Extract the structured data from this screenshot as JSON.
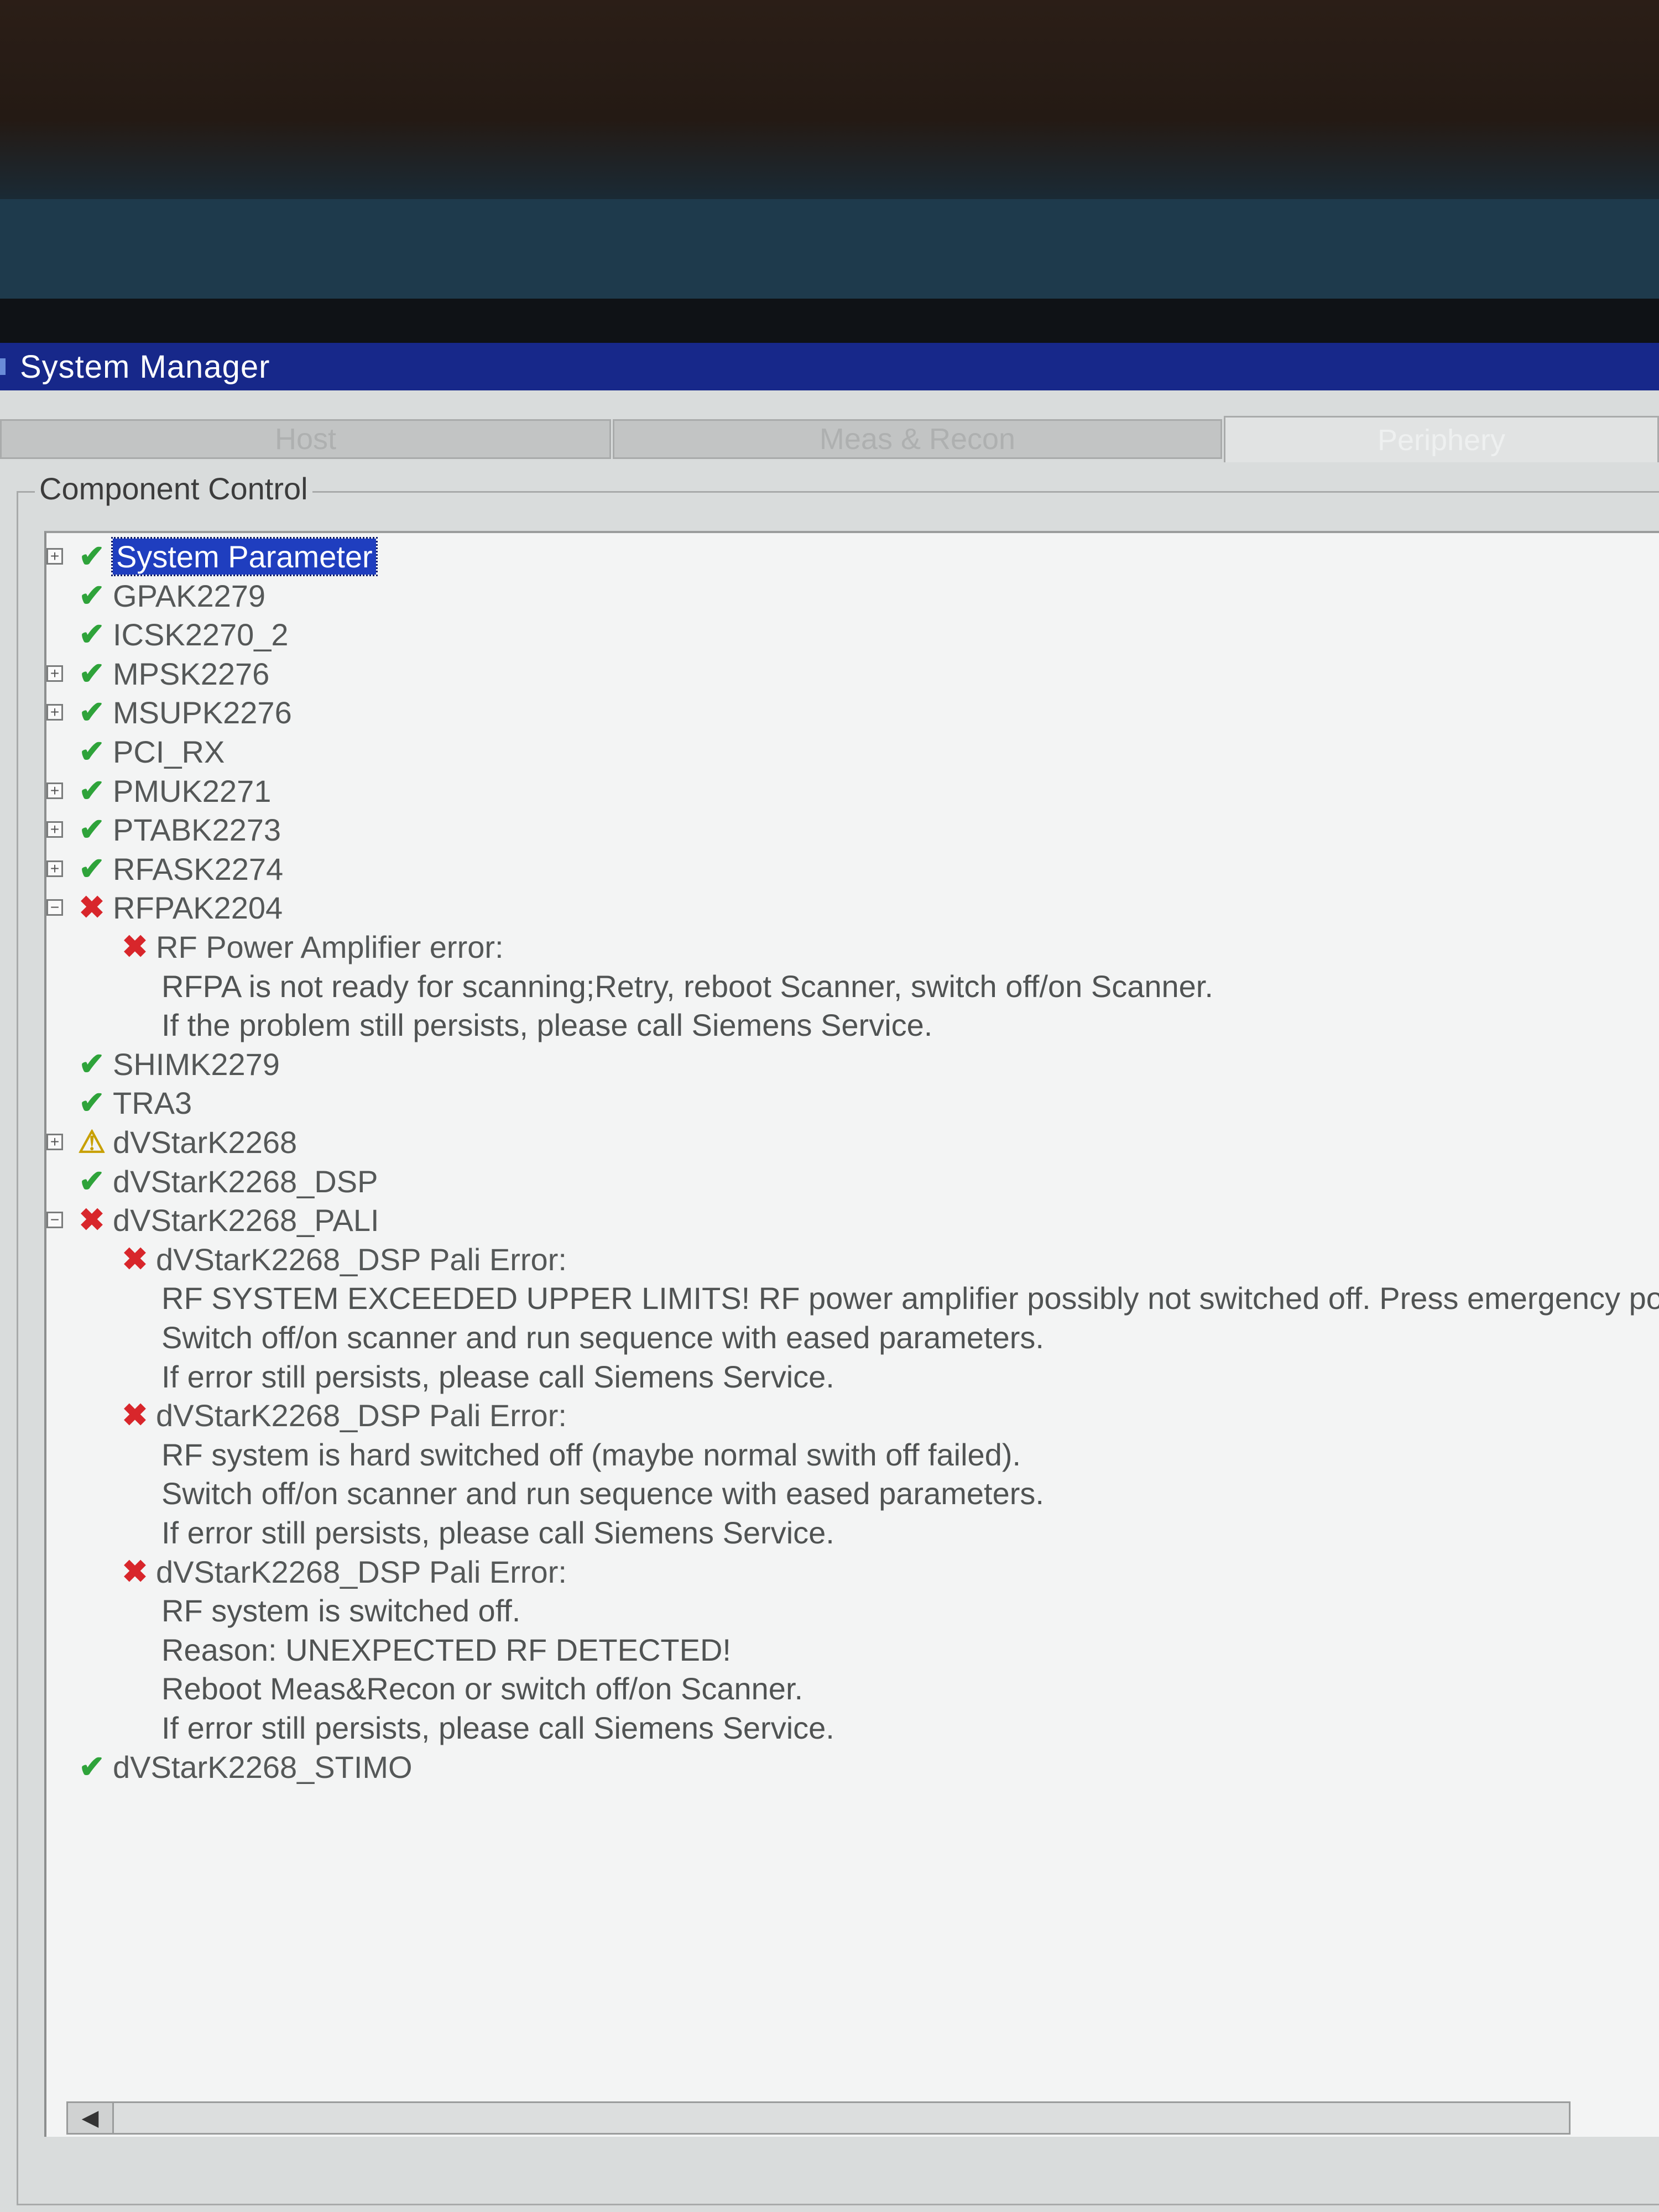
{
  "window": {
    "title": "System Manager"
  },
  "tabs": [
    {
      "label": "Host",
      "active": false
    },
    {
      "label": "Meas & Recon",
      "active": false
    },
    {
      "label": "Periphery",
      "active": true
    }
  ],
  "component_control": {
    "label": "Component Control",
    "items": [
      {
        "label": "System Parameter",
        "status": "ok",
        "expander": "plus",
        "selected": true
      },
      {
        "label": "GPAK2279",
        "status": "ok",
        "expander": ""
      },
      {
        "label": "ICSK2270_2",
        "status": "ok",
        "expander": ""
      },
      {
        "label": "MPSK2276",
        "status": "ok",
        "expander": "plus"
      },
      {
        "label": "MSUPK2276",
        "status": "ok",
        "expander": "plus"
      },
      {
        "label": "PCI_RX",
        "status": "ok",
        "expander": ""
      },
      {
        "label": "PMUK2271",
        "status": "ok",
        "expander": "plus"
      },
      {
        "label": "PTABK2273",
        "status": "ok",
        "expander": "plus"
      },
      {
        "label": "RFASK2274",
        "status": "ok",
        "expander": "plus"
      },
      {
        "label": "RFPAK2204",
        "status": "error",
        "expander": "minus"
      },
      {
        "label": "RF Power Amplifier error:",
        "status": "error",
        "child": true
      },
      {
        "label": "RFPA is not ready for scanning;Retry, reboot Scanner, switch off/on Scanner.",
        "status": "",
        "detail": true
      },
      {
        "label": "If the problem still persists, please call Siemens Service.",
        "status": "",
        "detail": true
      },
      {
        "label": "SHIMK2279",
        "status": "ok",
        "expander": ""
      },
      {
        "label": "TRA3",
        "status": "ok",
        "expander": ""
      },
      {
        "label": "dVStarK2268",
        "status": "warning",
        "expander": "plus"
      },
      {
        "label": "dVStarK2268_DSP",
        "status": "ok",
        "expander": ""
      },
      {
        "label": "dVStarK2268_PALI",
        "status": "error",
        "expander": "minus"
      },
      {
        "label": "dVStarK2268_DSP Pali Error:",
        "status": "error",
        "child": true
      },
      {
        "label": "RF SYSTEM EXCEEDED UPPER LIMITS! RF power amplifier possibly not switched off. Press emergency powe",
        "status": "",
        "detail": true
      },
      {
        "label": "Switch off/on scanner and run sequence with eased parameters.",
        "status": "",
        "detail": true
      },
      {
        "label": "If error still persists, please call Siemens Service.",
        "status": "",
        "detail": true
      },
      {
        "label": "dVStarK2268_DSP Pali Error:",
        "status": "error",
        "child": true
      },
      {
        "label": "RF system is hard switched off (maybe normal swith off failed).",
        "status": "",
        "detail": true
      },
      {
        "label": "Switch off/on scanner and run sequence with eased parameters.",
        "status": "",
        "detail": true
      },
      {
        "label": "If error still persists, please call Siemens Service.",
        "status": "",
        "detail": true
      },
      {
        "label": "dVStarK2268_DSP Pali Error:",
        "status": "error",
        "child": true
      },
      {
        "label": "RF system is switched off.",
        "status": "",
        "detail": true
      },
      {
        "label": "Reason: UNEXPECTED RF DETECTED!",
        "status": "",
        "detail": true
      },
      {
        "label": "Reboot Meas&Recon or switch off/on Scanner.",
        "status": "",
        "detail": true
      },
      {
        "label": "If error still persists, please call Siemens Service.",
        "status": "",
        "detail": true
      },
      {
        "label": "dVStarK2268_STIMO",
        "status": "ok",
        "expander": ""
      }
    ]
  },
  "icons": {
    "ok": "check-icon",
    "error": "cross-icon",
    "warning": "warning-icon",
    "scroll_left": "scroll-left-arrow-icon"
  },
  "colors": {
    "ok": "#2ea33a",
    "error": "#d8262b",
    "warning": "#c8a000",
    "selection": "#1f3ebf",
    "titlebar": "#17288a"
  }
}
